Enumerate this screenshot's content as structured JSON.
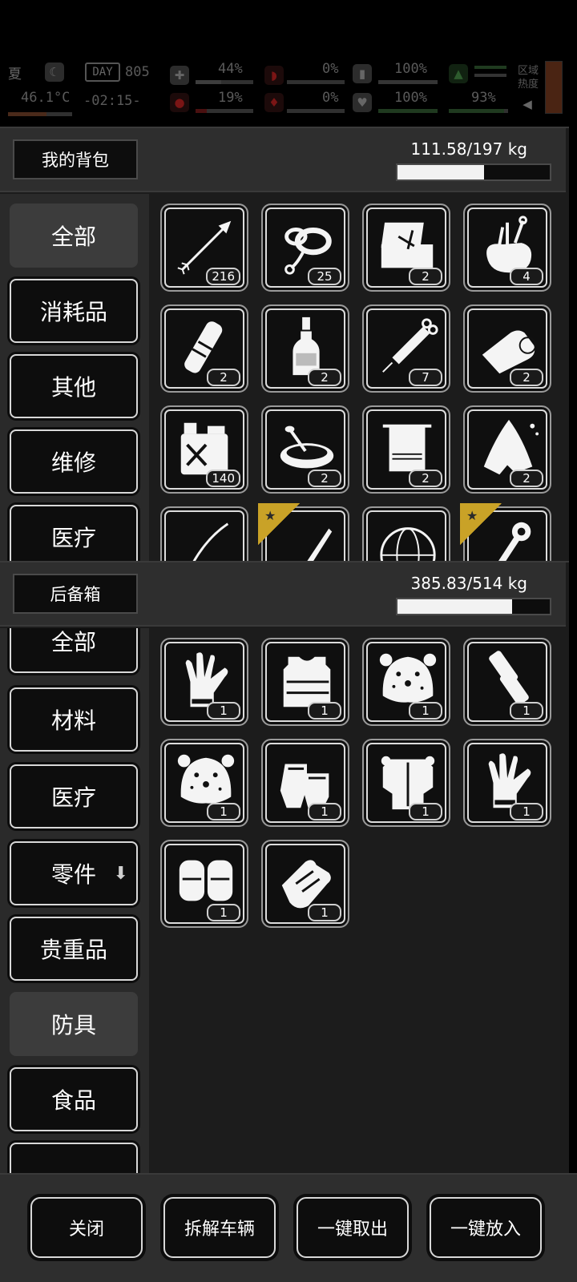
{
  "status": {
    "season": "夏",
    "temperature": "46.1°C",
    "day_label": "DAY",
    "day_number": "805",
    "time": "-02:15-",
    "health_pct": "44%",
    "hunger_pct": "0%",
    "stamina_pct": "100%",
    "bleed_pct": "19%",
    "thirst_pct": "0%",
    "heart_pct": "100%",
    "mood_pct": "93%",
    "zone_label": "区域热度"
  },
  "backpack": {
    "title": "我的背包",
    "weight": "111.58/197 kg",
    "fill_fraction": 0.566,
    "categories": [
      "全部",
      "消耗品",
      "其他",
      "维修",
      "医疗"
    ],
    "active_category": "全部",
    "items": [
      {
        "icon": "arrow-icon",
        "count": "216"
      },
      {
        "icon": "rope-icon",
        "count": "25"
      },
      {
        "icon": "toolbox-icon",
        "count": "2"
      },
      {
        "icon": "tool-bag-icon",
        "count": "4"
      },
      {
        "icon": "flashlight-icon",
        "count": "2"
      },
      {
        "icon": "bottle-icon",
        "count": "2"
      },
      {
        "icon": "syringe-icon",
        "count": "7"
      },
      {
        "icon": "bandage-icon",
        "count": "2"
      },
      {
        "icon": "fuel-can-icon",
        "count": "140"
      },
      {
        "icon": "bowl-icon",
        "count": "2"
      },
      {
        "icon": "towel-icon",
        "count": "2"
      },
      {
        "icon": "cloth-icon",
        "count": "2"
      },
      {
        "icon": "wire-icon",
        "count": ""
      },
      {
        "icon": "blade-icon",
        "count": ""
      },
      {
        "icon": "globe-icon",
        "count": ""
      },
      {
        "icon": "wrench-icon",
        "count": ""
      }
    ]
  },
  "storage": {
    "title": "后备箱",
    "weight": "385.83/514 kg",
    "fill_fraction": 0.751,
    "categories": [
      "全部",
      "材料",
      "医疗",
      "零件",
      "贵重品",
      "防具",
      "食品"
    ],
    "active_category": "防具",
    "items": [
      {
        "icon": "glove-icon",
        "count": "1"
      },
      {
        "icon": "vest-icon",
        "count": "1"
      },
      {
        "icon": "leopard-hat-icon",
        "count": "1"
      },
      {
        "icon": "arm-guard-icon",
        "count": "1"
      },
      {
        "icon": "leopard-hat-icon",
        "count": "1"
      },
      {
        "icon": "fingerless-gloves-icon",
        "count": "1"
      },
      {
        "icon": "body-armor-icon",
        "count": "1"
      },
      {
        "icon": "glove-icon",
        "count": "1"
      },
      {
        "icon": "knee-pads-icon",
        "count": "1"
      },
      {
        "icon": "tactical-gloves-icon",
        "count": "1"
      }
    ]
  },
  "footer": {
    "close": "关闭",
    "dismantle": "拆解车辆",
    "take_all": "一键取出",
    "put_all": "一键放入"
  }
}
